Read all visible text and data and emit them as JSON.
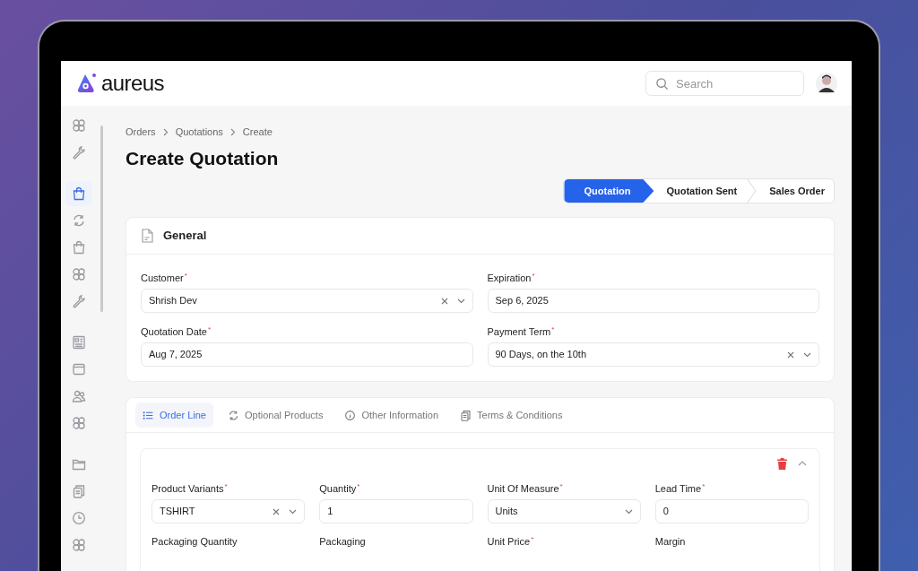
{
  "header": {
    "logo_text": "aureus",
    "search": {
      "placeholder": "Search"
    }
  },
  "sidebar": {
    "groups": [
      {
        "items": [
          {
            "selected": false
          },
          {
            "selected": false
          }
        ]
      },
      {
        "items": [
          {
            "selected": true
          },
          {
            "selected": false
          },
          {
            "selected": false
          },
          {
            "selected": false
          },
          {
            "selected": false
          }
        ]
      },
      {
        "items": [
          {
            "selected": false
          },
          {
            "selected": false
          },
          {
            "selected": false
          },
          {
            "selected": false
          }
        ]
      },
      {
        "items": [
          {
            "selected": false
          },
          {
            "selected": false
          },
          {
            "selected": false
          },
          {
            "selected": false
          }
        ]
      }
    ]
  },
  "breadcrumb": [
    "Orders",
    "Quotations",
    "Create"
  ],
  "title": "Create Quotation",
  "stepper": [
    {
      "label": "Quotation",
      "selected": true
    },
    {
      "label": "Quotation Sent",
      "selected": false
    },
    {
      "label": "Sales Order",
      "selected": false
    }
  ],
  "general": {
    "title": "General",
    "fields": [
      {
        "label": "Customer",
        "required_mark": "*",
        "kind": "select",
        "value": "Shrish Dev",
        "clearable": true
      },
      {
        "label": "Expiration",
        "required_mark": "*",
        "kind": "input",
        "value": "Sep 6, 2025"
      },
      {
        "label": "Quotation Date",
        "required_mark": "*",
        "kind": "input",
        "value": "Aug 7, 2025"
      },
      {
        "label": "Payment Term",
        "required_mark": "*",
        "kind": "select",
        "value": "90 Days, on the 10th",
        "clearable": true
      }
    ]
  },
  "tabs": [
    {
      "label": "Order Line",
      "selected": true
    },
    {
      "label": "Optional Products",
      "selected": false
    },
    {
      "label": "Other Information",
      "selected": false
    },
    {
      "label": "Terms & Conditions",
      "selected": false
    }
  ],
  "order_line": {
    "expanded": true,
    "fields": [
      {
        "label": "Product Variants",
        "required_mark": "*",
        "kind": "select",
        "value": "TSHIRT",
        "clearable": true
      },
      {
        "label": "Quantity",
        "required_mark": "*",
        "kind": "input",
        "value": "1"
      },
      {
        "label": "Unit Of Measure",
        "required_mark": "*",
        "kind": "select",
        "value": "Units"
      },
      {
        "label": "Lead Time",
        "required_mark": "*",
        "kind": "input",
        "value": "0"
      },
      {
        "label": "Packaging Quantity",
        "kind": "label"
      },
      {
        "label": "Packaging",
        "kind": "label"
      },
      {
        "label": "Unit Price",
        "required_mark": "*",
        "kind": "label"
      },
      {
        "label": "Margin",
        "kind": "label"
      }
    ]
  }
}
